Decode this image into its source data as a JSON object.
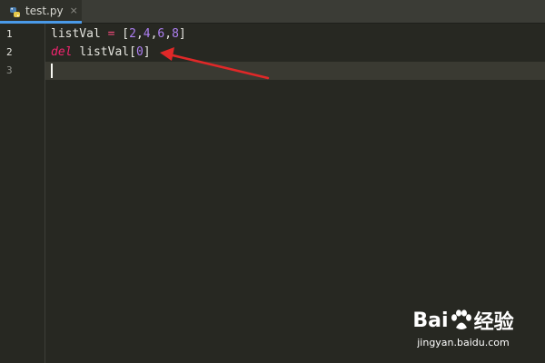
{
  "tab": {
    "label": "test.py",
    "close": "×",
    "icon": "python-file-icon"
  },
  "line_numbers": [
    "1",
    "2",
    "3"
  ],
  "code": {
    "line1": {
      "ident": "listVal",
      "eq": "=",
      "open": "[",
      "n1": "2",
      "c1": ",",
      "n2": "4",
      "c2": ",",
      "n3": "6",
      "c3": ",",
      "n4": "8",
      "close": "]"
    },
    "line2": {
      "kw": "del",
      "ident": "listVal",
      "open": "[",
      "n1": "0",
      "close": "]"
    }
  },
  "watermark": {
    "logo_text": "Bai",
    "logo_du": "du",
    "logo_cn": "经验",
    "url": "jingyan.baidu.com"
  },
  "colors": {
    "background": "#272822",
    "keyword": "#f0246e",
    "number": "#ad7ff2",
    "tab_accent": "#4a9ae8",
    "arrow": "#e02828"
  }
}
